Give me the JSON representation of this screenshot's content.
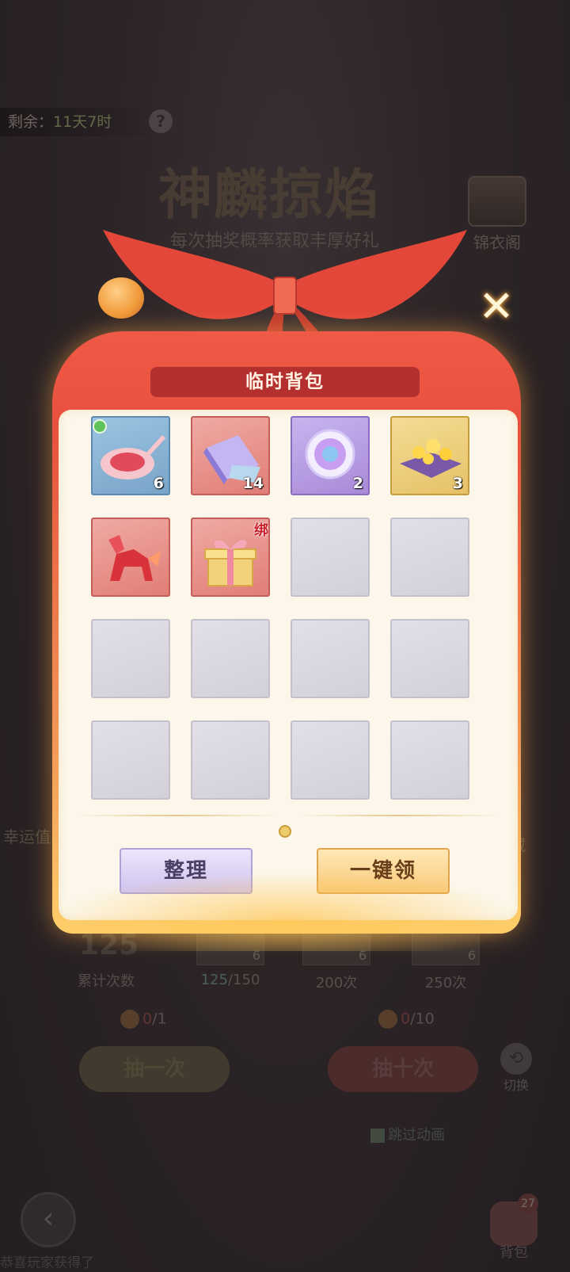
{
  "background": {
    "timer_label": "剩余：",
    "timer_value": "11天7时",
    "event_title": "神麟掠焰",
    "event_subtitle": "每次抽奖概率获取丰厚好礼",
    "wardrobe_label": "锦衣阁",
    "luck_label": "幸运值",
    "collection_label": "藏",
    "count_value": "125",
    "count_label": "累计次数",
    "milestones": [
      {
        "current": "125",
        "target": "/150",
        "qty": "6"
      },
      {
        "label": "200次",
        "qty": "6"
      },
      {
        "label": "250次",
        "qty": "6"
      }
    ],
    "ticket_one": {
      "have": "0",
      "need": "/1"
    },
    "ticket_ten": {
      "have": "0",
      "need": "/10"
    },
    "draw_one_label": "抽一次",
    "draw_ten_label": "抽十次",
    "switch_label": "切换",
    "skip_label": "跳过动画",
    "bag_label": "背包",
    "bag_badge": "27",
    "ticker_text": "恭喜玩家获得了"
  },
  "modal": {
    "title": "临时背包",
    "items": [
      {
        "name": "jelly-spoon",
        "rarity": "blue",
        "qty": "6"
      },
      {
        "name": "fabric-roll",
        "rarity": "red",
        "qty": "14"
      },
      {
        "name": "gem",
        "rarity": "purple",
        "qty": "2"
      },
      {
        "name": "gold-chest",
        "rarity": "gold",
        "qty": "3"
      },
      {
        "name": "qilin-mount",
        "rarity": "red",
        "qty": ""
      },
      {
        "name": "gift-box",
        "rarity": "red",
        "qty": "",
        "bound": "绑"
      }
    ],
    "total_slots": 16,
    "sort_label": "整理",
    "claim_all_label": "一键领"
  },
  "colors": {
    "bag_red": "#e8503e",
    "panel_cream": "#fcf7ea",
    "accent_gold": "#f9c978",
    "accent_purple": "#cfc3ef"
  }
}
